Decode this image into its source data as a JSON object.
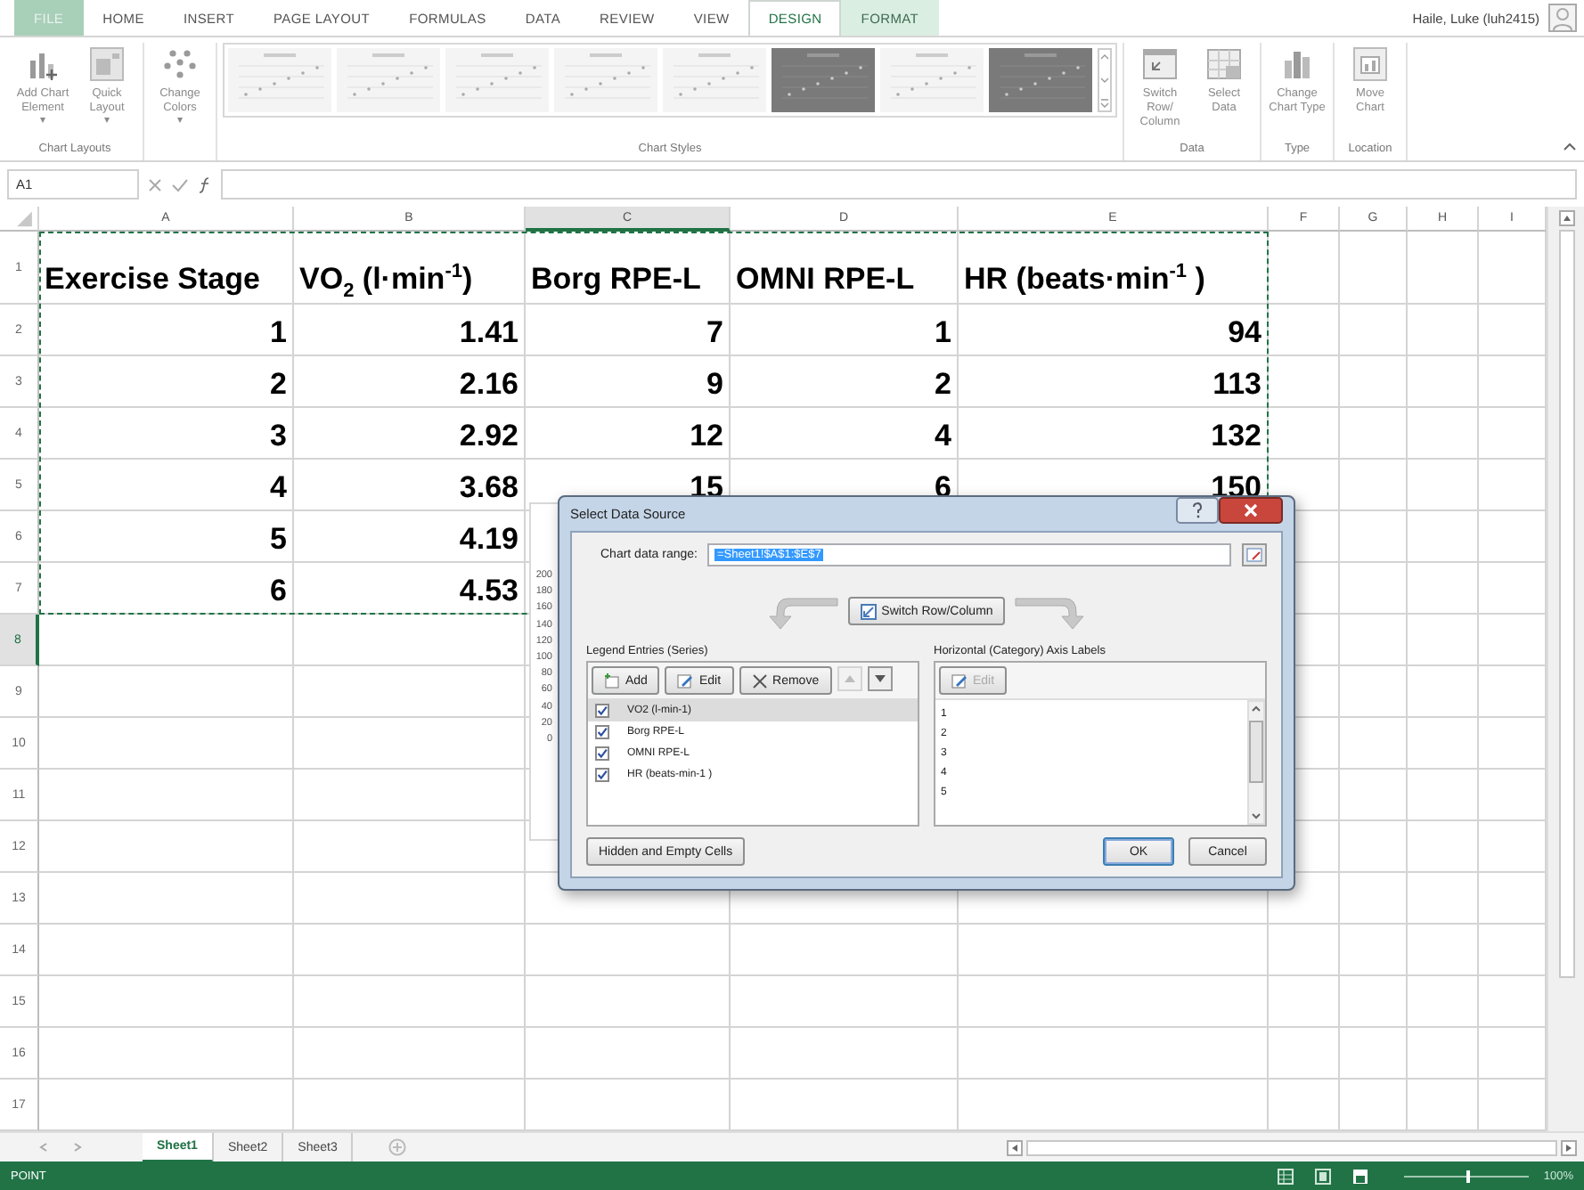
{
  "ribbon_tabs": [
    {
      "label": "FILE",
      "selected": false,
      "kind": "file"
    },
    {
      "label": "HOME",
      "selected": false,
      "kind": "plain"
    },
    {
      "label": "INSERT",
      "selected": false,
      "kind": "plain"
    },
    {
      "label": "PAGE LAYOUT",
      "selected": false,
      "kind": "plain"
    },
    {
      "label": "FORMULAS",
      "selected": false,
      "kind": "plain"
    },
    {
      "label": "DATA",
      "selected": false,
      "kind": "plain"
    },
    {
      "label": "REVIEW",
      "selected": false,
      "kind": "plain"
    },
    {
      "label": "VIEW",
      "selected": false,
      "kind": "plain"
    },
    {
      "label": "DESIGN",
      "selected": true,
      "kind": "context"
    },
    {
      "label": "FORMAT",
      "selected": false,
      "kind": "context"
    }
  ],
  "user": "Haile, Luke (luh2415)",
  "ribbon_groups": [
    {
      "label": "Chart Layouts",
      "kind": "buttons",
      "buttons": [
        {
          "label": "Add Chart Element",
          "caret": "▾"
        },
        {
          "label": "Quick Layout",
          "caret": "▾"
        }
      ]
    },
    {
      "kind": "buttons",
      "buttons": [
        {
          "label": "Change Colors",
          "caret": "▾"
        }
      ]
    },
    {
      "label": "Chart Styles",
      "kind": "gallery",
      "styles": [
        {
          "kind": "light"
        },
        {
          "kind": "light"
        },
        {
          "kind": "light"
        },
        {
          "kind": "light"
        },
        {
          "kind": "light"
        },
        {
          "kind": "dark"
        },
        {
          "kind": "light"
        },
        {
          "kind": "dark"
        }
      ]
    },
    {
      "label": "Data",
      "kind": "buttons",
      "buttons": [
        {
          "label": "Switch Row/ Column"
        },
        {
          "label": "Select Data"
        }
      ]
    },
    {
      "label": "Type",
      "kind": "buttons",
      "buttons": [
        {
          "label": "Change Chart Type"
        }
      ]
    },
    {
      "label": "Location",
      "kind": "buttons",
      "buttons": [
        {
          "label": "Move Chart"
        }
      ]
    }
  ],
  "name_box": "A1",
  "columns": [
    {
      "label": "A",
      "selected": false
    },
    {
      "label": "B",
      "selected": false
    },
    {
      "label": "C",
      "selected": true
    },
    {
      "label": "D",
      "selected": false
    },
    {
      "label": "E",
      "selected": false
    },
    {
      "label": "F",
      "selected": false
    },
    {
      "label": "G",
      "selected": false
    },
    {
      "label": "H",
      "selected": false
    },
    {
      "label": "I",
      "selected": false
    }
  ],
  "rows": [
    {
      "header": "1",
      "selected": false,
      "kind": "header",
      "cells": [
        "Exercise Stage",
        "VO$_{2}$ (l·min$^{-1}$)",
        "Borg RPE-L",
        "OMNI RPE-L",
        "HR (beats·min$^{-1}$ )"
      ]
    },
    {
      "header": "2",
      "selected": false,
      "kind": "data",
      "cells": [
        "1",
        "1.41",
        "7",
        "1",
        "94"
      ]
    },
    {
      "header": "3",
      "selected": false,
      "kind": "data",
      "cells": [
        "2",
        "2.16",
        "9",
        "2",
        "113"
      ]
    },
    {
      "header": "4",
      "selected": false,
      "kind": "data",
      "cells": [
        "3",
        "2.92",
        "12",
        "4",
        "132"
      ]
    },
    {
      "header": "5",
      "selected": false,
      "kind": "data",
      "cells": [
        "4",
        "3.68",
        "15",
        "6",
        "150"
      ]
    },
    {
      "header": "6",
      "selected": false,
      "kind": "data",
      "cells": [
        "5",
        "4.19"
      ]
    },
    {
      "header": "7",
      "selected": false,
      "kind": "data",
      "cells": [
        "6",
        "4.53"
      ]
    },
    {
      "header": "8",
      "selected": true,
      "kind": "data",
      "cells": []
    },
    {
      "header": "9",
      "selected": false,
      "kind": "data",
      "cells": []
    },
    {
      "header": "10",
      "selected": false,
      "kind": "data",
      "cells": []
    },
    {
      "header": "11",
      "selected": false,
      "kind": "data",
      "cells": []
    },
    {
      "header": "12",
      "selected": false,
      "kind": "data",
      "cells": []
    },
    {
      "header": "13",
      "selected": false,
      "kind": "data",
      "cells": []
    },
    {
      "header": "14",
      "selected": false,
      "kind": "data",
      "cells": []
    },
    {
      "header": "15",
      "selected": false,
      "kind": "data",
      "cells": []
    },
    {
      "header": "16",
      "selected": false,
      "kind": "data",
      "cells": []
    },
    {
      "header": "17",
      "selected": false,
      "kind": "data",
      "cells": []
    }
  ],
  "chart_ticks": [
    "200",
    "180",
    "160",
    "140",
    "120",
    "100",
    "80",
    "60",
    "40",
    "20",
    "0"
  ],
  "dialog": {
    "title": "Select Data Source",
    "range_label": "Chart data range:",
    "range_value": "=Sheet1!$A$1:$E$7",
    "switch_button": "Switch Row/Column",
    "legend_title": "Legend Entries (Series)",
    "legend_buttons": [
      {
        "label": "Add"
      },
      {
        "label": "Edit"
      },
      {
        "label": "Remove"
      }
    ],
    "move_up_disabled": true,
    "series": [
      {
        "label": "VO2 (l-min-1)",
        "checked": true,
        "selected": true
      },
      {
        "label": "Borg RPE-L",
        "checked": true,
        "selected": false
      },
      {
        "label": "OMNI RPE-L",
        "checked": true,
        "selected": false
      },
      {
        "label": "HR (beats-min-1 )",
        "checked": true,
        "selected": false
      }
    ],
    "axis_title": "Horizontal (Category) Axis Labels",
    "axis_edit": {
      "label": "Edit",
      "disabled": true
    },
    "axis_labels": [
      "1",
      "2",
      "3",
      "4",
      "5"
    ],
    "hidden_button": "Hidden and Empty Cells",
    "ok": "OK",
    "cancel": "Cancel"
  },
  "sheet_tabs": [
    {
      "label": "Sheet1",
      "selected": true
    },
    {
      "label": "Sheet2",
      "selected": false
    },
    {
      "label": "Sheet3",
      "selected": false
    }
  ],
  "status": "POINT",
  "zoom": {
    "level": 0.5,
    "reading": "100%"
  }
}
